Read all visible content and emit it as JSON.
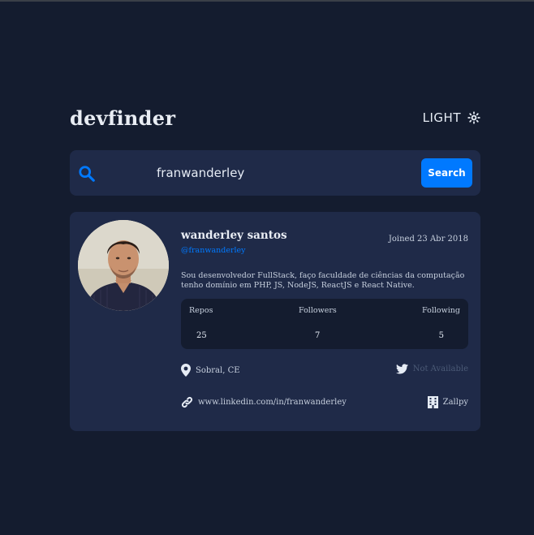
{
  "app": {
    "logo": "devfinder",
    "theme_label": "LIGHT",
    "theme_icon": "sun-icon"
  },
  "search": {
    "value": "franwanderley",
    "button_label": "Search",
    "icon": "search-icon"
  },
  "colors": {
    "background": "#141c2f",
    "card": "#1f2a48",
    "accent": "#0079ff",
    "muted": "#4b5a76"
  },
  "profile": {
    "name": "wanderley santos",
    "login": "@franwanderley",
    "joined": "Joined 23 Abr 2018",
    "bio_line1": "Sou desenvolvedor FullStack, faço faculdade de ciências da computação",
    "bio_line2": "tenho domínio em PHP, JS, NodeJS, ReactJS e React Native.",
    "stats": {
      "repos_label": "Repos",
      "repos": "25",
      "followers_label": "Followers",
      "followers": "7",
      "following_label": "Following",
      "following": "5"
    },
    "location": "Sobral, CE",
    "twitter": "Not Available",
    "blog": "www.linkedin.com/in/franwanderley",
    "company": "Zallpy"
  }
}
